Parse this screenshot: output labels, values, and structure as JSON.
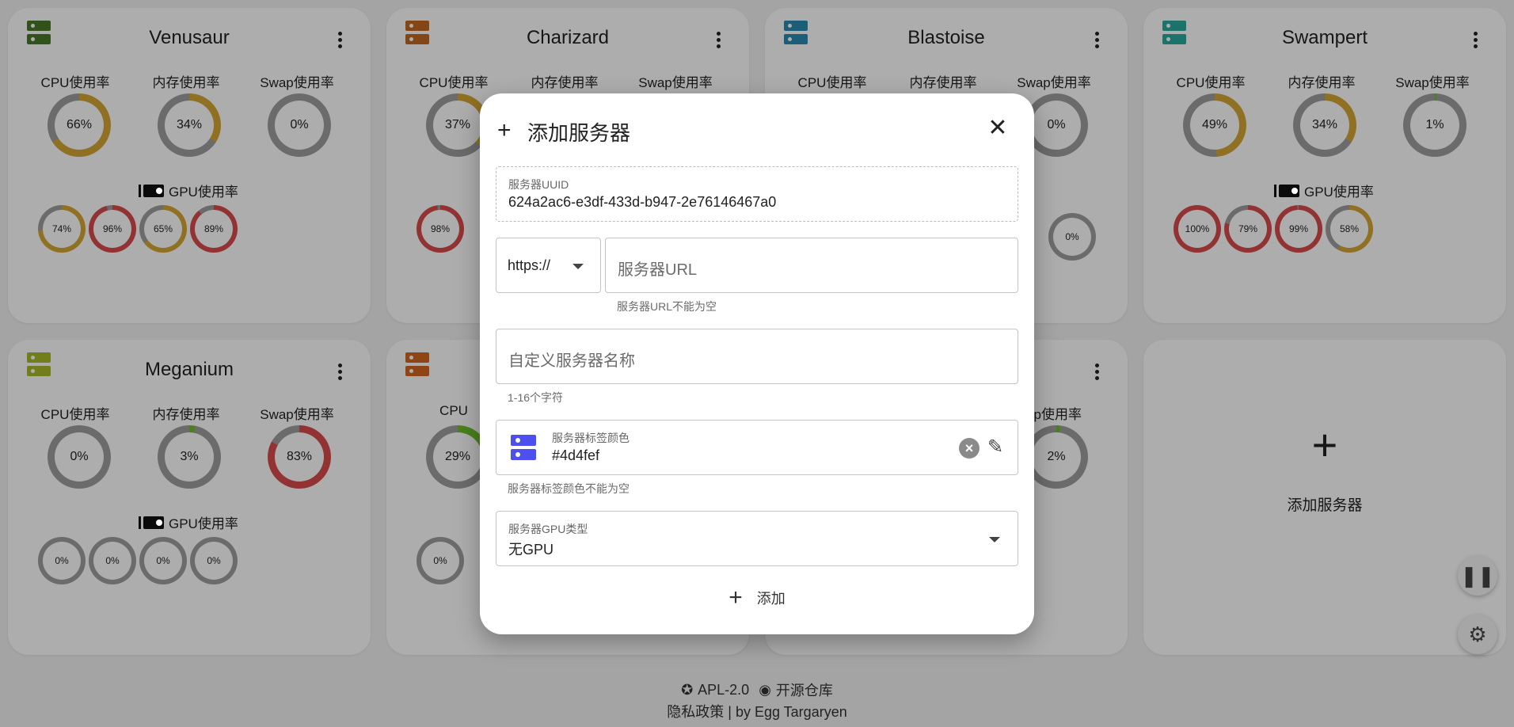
{
  "cards": [
    {
      "name": "Venusaur",
      "color": "#4b7a2a",
      "cpu_label": "CPU使用率",
      "mem_label": "内存使用率",
      "swap_label": "Swap使用率",
      "cpu": {
        "value": 66,
        "text": "66%"
      },
      "mem": {
        "value": 34,
        "text": "34%"
      },
      "swap": {
        "value": 0,
        "text": "0%"
      },
      "gpu_label": "GPU使用率",
      "gpus": [
        {
          "value": 74,
          "text": "74%"
        },
        {
          "value": 96,
          "text": "96%"
        },
        {
          "value": 65,
          "text": "65%"
        },
        {
          "value": 89,
          "text": "89%"
        }
      ]
    },
    {
      "name": "Charizard",
      "color": "#c2681e",
      "cpu_label": "CPU使用率",
      "mem_label": "内存使用率",
      "swap_label": "Swap使用率",
      "cpu": {
        "value": 37,
        "text": "37%"
      },
      "gpu_first": {
        "value": 98,
        "text": "98%"
      }
    },
    {
      "name": "Blastoise",
      "color": "#2a8ab0",
      "cpu_label": "CPU使用率",
      "mem_label": "内存使用率",
      "swap_label": "Swap使用率",
      "swap": {
        "value": 0,
        "text": "0%"
      },
      "gpu_last": {
        "value": 0,
        "text": "0%"
      }
    },
    {
      "name": "Swampert",
      "color": "#2aaaa0",
      "cpu_label": "CPU使用率",
      "mem_label": "内存使用率",
      "swap_label": "Swap使用率",
      "cpu": {
        "value": 49,
        "text": "49%"
      },
      "mem": {
        "value": 34,
        "text": "34%"
      },
      "swap": {
        "value": 1,
        "text": "1%"
      },
      "gpu_label": "GPU使用率",
      "gpus": [
        {
          "value": 100,
          "text": "100%"
        },
        {
          "value": 79,
          "text": "79%"
        },
        {
          "value": 99,
          "text": "99%"
        },
        {
          "value": 58,
          "text": "58%"
        }
      ]
    },
    {
      "name": "Meganium",
      "color": "#a8b828",
      "cpu_label": "CPU使用率",
      "mem_label": "内存使用率",
      "swap_label": "Swap使用率",
      "cpu": {
        "value": 0,
        "text": "0%"
      },
      "mem": {
        "value": 3,
        "text": "3%"
      },
      "swap": {
        "value": 83,
        "text": "83%"
      },
      "gpu_label": "GPU使用率",
      "gpus": [
        {
          "value": 0,
          "text": "0%"
        },
        {
          "value": 0,
          "text": "0%"
        },
        {
          "value": 0,
          "text": "0%"
        },
        {
          "value": 0,
          "text": "0%"
        }
      ]
    },
    {
      "color": "#d2651e",
      "cpu_label_partial": "CPU",
      "cpu": {
        "value": 29,
        "text": "29%"
      },
      "gpu_first": {
        "value": 0,
        "text": "0%"
      }
    },
    {
      "swap_label_partial": "ap使用率",
      "swap": {
        "value": 2,
        "text": "2%"
      }
    }
  ],
  "add_card": {
    "plus": "+",
    "label": "添加服务器"
  },
  "colors": {
    "good": "#9e9e9e",
    "mid": "#d4a533",
    "high": "#d94b4b",
    "low": "#6cbf2a"
  },
  "footer": {
    "license": "APL-2.0",
    "repo": "开源仓库",
    "bottom": "隐私政策 | by Egg Targaryen"
  },
  "dialog": {
    "plus": "+",
    "title": "添加服务器",
    "close": "✕",
    "uuid_label": "服务器UUID",
    "uuid_value": "624a2ac6-e3df-433d-b947-2e76146467a0",
    "protocol": "https://",
    "url_placeholder": "服务器URL",
    "url_helper": "服务器URL不能为空",
    "name_placeholder": "自定义服务器名称",
    "name_helper": "1-16个字符",
    "color_label": "服务器标签颜色",
    "color_value": "#4d4fef",
    "color_helper": "服务器标签颜色不能为空",
    "gpu_label": "服务器GPU类型",
    "gpu_value": "无GPU",
    "add_plus": "+",
    "add_label": "添加"
  }
}
